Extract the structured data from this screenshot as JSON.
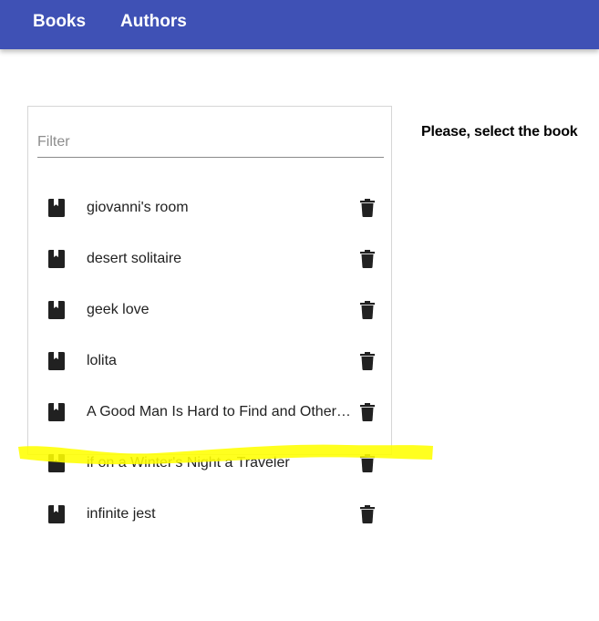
{
  "nav": {
    "books_label": "Books",
    "authors_label": "Authors",
    "bar_color": "#3f51b5"
  },
  "filter": {
    "placeholder": "Filter",
    "value": ""
  },
  "books": [
    {
      "title": "giovanni's room",
      "icon": "book-icon",
      "action_icon": "delete-icon"
    },
    {
      "title": "desert solitaire",
      "icon": "book-icon",
      "action_icon": "delete-icon"
    },
    {
      "title": "geek love",
      "icon": "book-icon",
      "action_icon": "delete-icon"
    },
    {
      "title": "lolita",
      "icon": "book-icon",
      "action_icon": "delete-icon"
    },
    {
      "title": "A Good Man Is Hard to Find and Other Stories",
      "icon": "book-icon",
      "action_icon": "delete-icon"
    },
    {
      "title": "if on a Winter's Night a Traveler",
      "icon": "book-icon",
      "action_icon": "delete-icon"
    },
    {
      "title": "infinite jest",
      "icon": "book-icon",
      "action_icon": "delete-icon"
    }
  ],
  "detail": {
    "message": "Please, select the book"
  },
  "annotation": {
    "highlight_color": "#ffff00"
  }
}
